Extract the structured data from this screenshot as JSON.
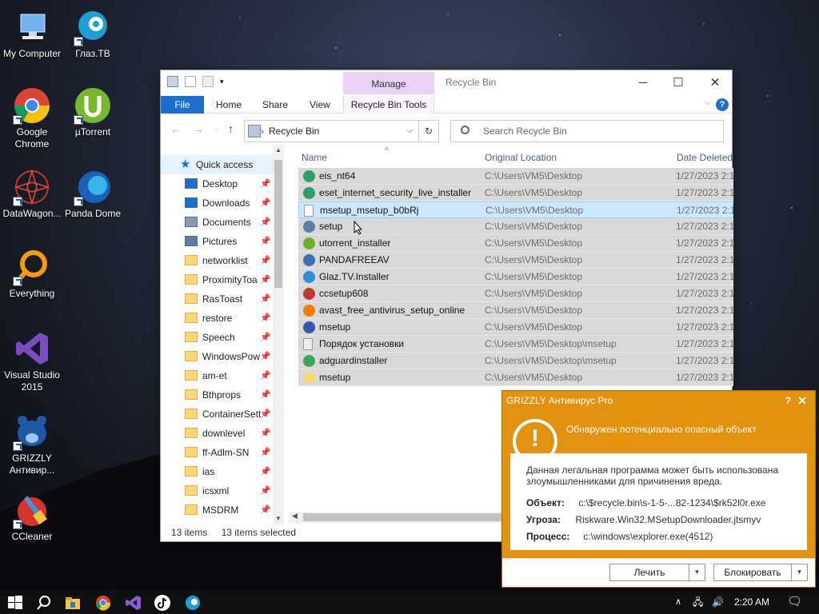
{
  "desktop_icons": [
    {
      "label": "My Computer",
      "icon": "my-computer-icon"
    },
    {
      "label": "Глаз.ТВ",
      "icon": "glaz-tv-icon"
    },
    {
      "label": "Google Chrome",
      "icon": "chrome-icon"
    },
    {
      "label": "µTorrent",
      "icon": "utorrent-icon"
    },
    {
      "label": "DataWagon...",
      "icon": "datawagon-icon"
    },
    {
      "label": "Panda Dome",
      "icon": "panda-dome-icon"
    },
    {
      "label": "Everything",
      "icon": "everything-icon"
    },
    {
      "label": "Visual Studio 2015",
      "icon": "visual-studio-icon"
    },
    {
      "label": "GRIZZLY Антивир...",
      "icon": "grizzly-icon"
    },
    {
      "label": "CCleaner",
      "icon": "ccleaner-icon"
    }
  ],
  "explorer": {
    "title": "Recycle Bin",
    "manage_tab": "Manage",
    "ribbon_tabs": [
      "File",
      "Home",
      "Share",
      "View",
      "Recycle Bin Tools"
    ],
    "address": "Recycle Bin",
    "search_placeholder": "Search Recycle Bin",
    "nav_quick_access": "Quick access",
    "nav_items": [
      "Desktop",
      "Downloads",
      "Documents",
      "Pictures",
      "networklist",
      "ProximityToa",
      "RasToast",
      "restore",
      "Speech",
      "WindowsPow",
      "am-et",
      "Bthprops",
      "ContainerSett",
      "downlevel",
      "ff-Adlm-SN",
      "ias",
      "icsxml",
      "MSDRM"
    ],
    "columns": [
      "Name",
      "Original Location",
      "Date Deleted"
    ],
    "rows": [
      {
        "name": "eis_nt64",
        "location": "C:\\Users\\VM5\\Desktop",
        "date": "1/27/2023 2:1",
        "color": "#2e9d6a"
      },
      {
        "name": "eset_internet_security_live_installer",
        "location": "C:\\Users\\VM5\\Desktop",
        "date": "1/27/2023 2:1",
        "color": "#2e9d6a"
      },
      {
        "name": "msetup_msetup_b0bRj",
        "location": "C:\\Users\\VM5\\Desktop",
        "date": "1/27/2023 2:1",
        "color": "#ffffff"
      },
      {
        "name": "setup",
        "location": "C:\\Users\\VM5\\Desktop",
        "date": "1/27/2023 2:1",
        "color": "#5a7fa8"
      },
      {
        "name": "utorrent_installer",
        "location": "C:\\Users\\VM5\\Desktop",
        "date": "1/27/2023 2:1",
        "color": "#6ab023"
      },
      {
        "name": "PANDAFREEAV",
        "location": "C:\\Users\\VM5\\Desktop",
        "date": "1/27/2023 2:1",
        "color": "#3b6fb6"
      },
      {
        "name": "Glaz.TV.Installer",
        "location": "C:\\Users\\VM5\\Desktop",
        "date": "1/27/2023 2:1",
        "color": "#2b8fd6"
      },
      {
        "name": "ccsetup608",
        "location": "C:\\Users\\VM5\\Desktop",
        "date": "1/27/2023 2:1",
        "color": "#c0392b"
      },
      {
        "name": "avast_free_antivirus_setup_online",
        "location": "C:\\Users\\VM5\\Desktop",
        "date": "1/27/2023 2:1",
        "color": "#f07d00"
      },
      {
        "name": "msetup",
        "location": "C:\\Users\\VM5\\Desktop",
        "date": "1/27/2023 2:1",
        "color": "#3355aa"
      },
      {
        "name": "Порядок установки",
        "location": "C:\\Users\\VM5\\Desktop\\msetup",
        "date": "1/27/2023 2:1",
        "color": "#eeeeee"
      },
      {
        "name": "adguardinstaller",
        "location": "C:\\Users\\VM5\\Desktop\\msetup",
        "date": "1/27/2023 2:1",
        "color": "#3aa757"
      },
      {
        "name": "msetup",
        "location": "C:\\Users\\VM5\\Desktop",
        "date": "1/27/2023 2:1",
        "color": "#f8d775"
      }
    ],
    "status_items": "13 items",
    "status_selected": "13 items selected"
  },
  "grizzly": {
    "title": "GRIZZLY Антивирус Pro",
    "help": "?",
    "headline": "Обнаружен потенциально опасный объект",
    "description": "Данная легальная программа может быть использована злоумышленниками для причинения вреда.",
    "object_label": "Объект:",
    "object_value": "c:\\$recycle.bin\\s-1-5-...82-1234\\$rk52l0r.exe",
    "threat_label": "Угроза:",
    "threat_value": "Riskware.Win32.MSetupDownloader.jtsmyv",
    "process_label": "Процесс:",
    "process_value": "c:\\windows\\explorer.exe(4512)",
    "treat_button": "Лечить",
    "block_button": "Блокировать",
    "accent": "#e2920f"
  },
  "taskbar": {
    "time": "2:20 AM"
  }
}
